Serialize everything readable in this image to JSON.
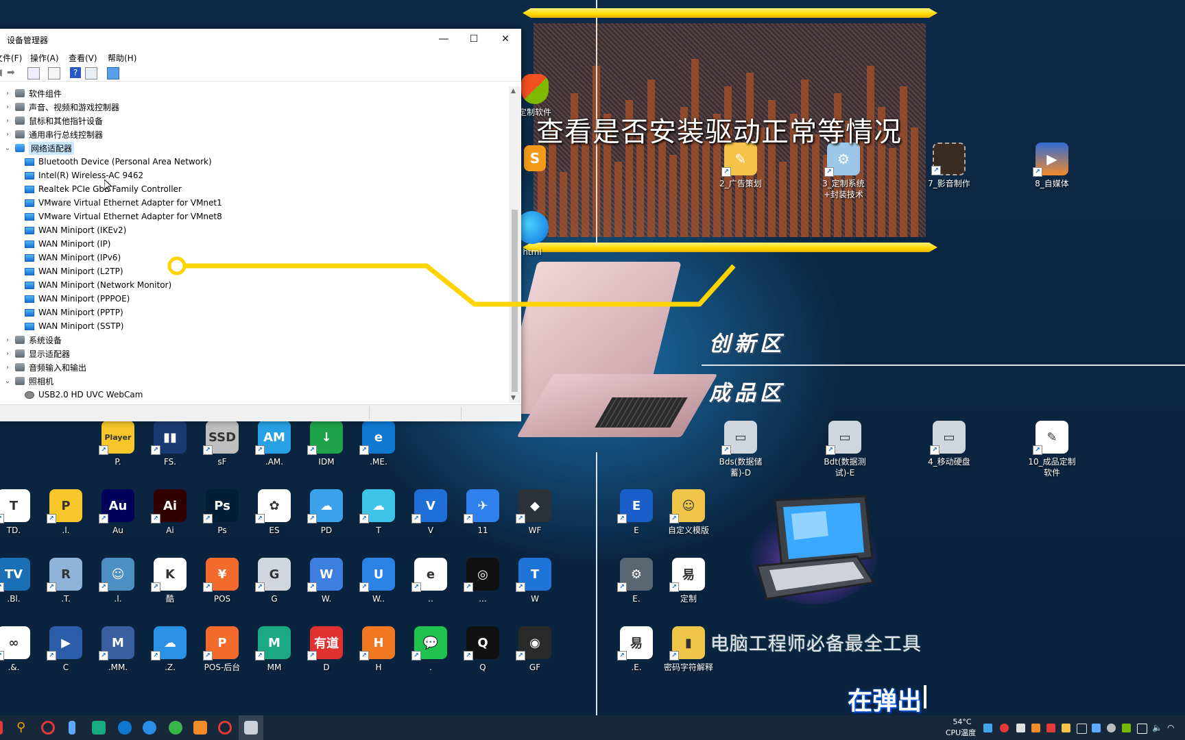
{
  "overlay": {
    "caption": "查看是否安装驱动正常等情况",
    "zone_innovation": "创新区",
    "zone_finished": "成品区",
    "tools_banner": "电脑工程师必备最全工具",
    "popup_text": "在弹出",
    "hud_icons": [
      "定制软件",
      "2_广告策划",
      "3_定制系统+封装技术",
      "7_影音制作",
      "8_自媒体",
      "html"
    ]
  },
  "window": {
    "title": "设备管理器",
    "menu": [
      "文件(F)",
      "操作(A)",
      "查看(V)",
      "帮助(H)"
    ],
    "tree": [
      {
        "label": "软件组件",
        "level": 0,
        "expanded": false
      },
      {
        "label": "声音、视频和游戏控制器",
        "level": 0,
        "expanded": false
      },
      {
        "label": "鼠标和其他指针设备",
        "level": 0,
        "expanded": false
      },
      {
        "label": "通用串行总线控制器",
        "level": 0,
        "expanded": false
      },
      {
        "label": "网络适配器",
        "level": 0,
        "expanded": true,
        "selected": true
      },
      {
        "label": "Bluetooth Device (Personal Area Network)",
        "level": 1
      },
      {
        "label": "Intel(R) Wireless-AC 9462",
        "level": 1
      },
      {
        "label": "Realtek PCIe GbE Family Controller",
        "level": 1
      },
      {
        "label": "VMware Virtual Ethernet Adapter for VMnet1",
        "level": 1
      },
      {
        "label": "VMware Virtual Ethernet Adapter for VMnet8",
        "level": 1
      },
      {
        "label": "WAN Miniport (IKEv2)",
        "level": 1
      },
      {
        "label": "WAN Miniport (IP)",
        "level": 1
      },
      {
        "label": "WAN Miniport (IPv6)",
        "level": 1
      },
      {
        "label": "WAN Miniport (L2TP)",
        "level": 1
      },
      {
        "label": "WAN Miniport (Network Monitor)",
        "level": 1
      },
      {
        "label": "WAN Miniport (PPPOE)",
        "level": 1
      },
      {
        "label": "WAN Miniport (PPTP)",
        "level": 1
      },
      {
        "label": "WAN Miniport (SSTP)",
        "level": 1
      },
      {
        "label": "系统设备",
        "level": 0,
        "expanded": false
      },
      {
        "label": "显示适配器",
        "level": 0,
        "expanded": false
      },
      {
        "label": "音频输入和输出",
        "level": 0,
        "expanded": false
      },
      {
        "label": "照相机",
        "level": 0,
        "expanded": true
      },
      {
        "label": "USB2.0 HD UVC WebCam",
        "level": 1,
        "camera": true
      }
    ]
  },
  "desktop_icons_left": [
    [
      {
        "label": "P.",
        "color": "#f7c72a",
        "glyph": "Player"
      },
      {
        "label": "FS.",
        "color": "#1a3a73",
        "glyph": "▮▮"
      },
      {
        "label": "sF",
        "color": "#bfbfbf",
        "glyph": "SSD"
      },
      {
        "label": ".AM.",
        "color": "#27a0e4",
        "glyph": "AM"
      },
      {
        "label": "IDM",
        "color": "#1ea34b",
        "glyph": "↓"
      },
      {
        "label": ".ME.",
        "color": "#0f79d1",
        "glyph": "e"
      }
    ],
    [
      {
        "label": "TD.",
        "color": "#ffffff",
        "glyph": "T"
      },
      {
        "label": ".l.",
        "color": "#f7c72a",
        "glyph": "P"
      },
      {
        "label": "Au",
        "color": "#00005b",
        "glyph": "Au"
      },
      {
        "label": "Ai",
        "color": "#330000",
        "glyph": "Ai"
      },
      {
        "label": "Ps",
        "color": "#001e36",
        "glyph": "Ps"
      },
      {
        "label": "ES",
        "color": "#ffffff",
        "glyph": "✿"
      },
      {
        "label": "PD",
        "color": "#3aa1ec",
        "glyph": "☁"
      },
      {
        "label": "T",
        "color": "#3fc3e8",
        "glyph": "☁"
      },
      {
        "label": "V",
        "color": "#1f6fd6",
        "glyph": "V"
      },
      {
        "label": "11",
        "color": "#2f80ed",
        "glyph": "✈"
      },
      {
        "label": "WF",
        "color": "#2d3238",
        "glyph": "◆"
      }
    ],
    [
      {
        "label": ".Bl.",
        "color": "#1b6fb5",
        "glyph": "TV"
      },
      {
        "label": ".T.",
        "color": "#8fb2d8",
        "glyph": "R"
      },
      {
        "label": ".l.",
        "color": "#4c8fc2",
        "glyph": "☺"
      },
      {
        "label": "酷",
        "color": "#ffffff",
        "glyph": "K"
      },
      {
        "label": "POS",
        "color": "#f26b2c",
        "glyph": "¥"
      },
      {
        "label": "G",
        "color": "#d0d6dc",
        "glyph": "G"
      },
      {
        "label": "W.",
        "color": "#3c7fe0",
        "glyph": "W"
      },
      {
        "label": "W..",
        "color": "#2b83e4",
        "glyph": "U"
      },
      {
        "label": "..",
        "color": "#ffffff",
        "glyph": "e"
      },
      {
        "label": "...",
        "color": "#111111",
        "glyph": "◎"
      },
      {
        "label": "W",
        "color": "#1f74d8",
        "glyph": "T"
      }
    ],
    [
      {
        "label": ".&.",
        "color": "#ffffff",
        "glyph": "∞"
      },
      {
        "label": "C",
        "color": "#2b5da8",
        "glyph": "▶"
      },
      {
        "label": ".MM.",
        "color": "#3a5fa0",
        "glyph": "M"
      },
      {
        "label": ".Z.",
        "color": "#2a92e6",
        "glyph": "☁"
      },
      {
        "label": "POS-后台",
        "color": "#f26b2c",
        "glyph": "P"
      },
      {
        "label": "MM",
        "color": "#1aa980",
        "glyph": "M"
      },
      {
        "label": "D",
        "color": "#e03030",
        "glyph": "有道"
      },
      {
        "label": "H",
        "color": "#f07820",
        "glyph": "H"
      },
      {
        "label": ".",
        "color": "#20c24f",
        "glyph": "💬"
      },
      {
        "label": "Q",
        "color": "#111111",
        "glyph": "Q"
      },
      {
        "label": "GF",
        "color": "#2a2a2a",
        "glyph": "◉"
      }
    ]
  ],
  "desktop_icons_right": [
    {
      "label": "Bds(数据储蓄)-D",
      "color": "#cfd6dc",
      "glyph": "▭"
    },
    {
      "label": "Bdt(数据测试)-E",
      "color": "#cfd6dc",
      "glyph": "▭"
    },
    {
      "label": "4_移动硬盘",
      "color": "#cfd6dc",
      "glyph": "▭"
    },
    {
      "label": "10_成品定制软件",
      "color": "#ffffff",
      "glyph": "✎"
    },
    {
      "label": "E",
      "color": "#1a5ec9",
      "glyph": "E"
    },
    {
      "label": "自定义模版",
      "color": "#f0c64a",
      "glyph": "☺"
    },
    {
      "label": "E.",
      "color": "#5a6672",
      "glyph": "⚙"
    },
    {
      "label": "定制",
      "color": "#ffffff",
      "glyph": "易"
    },
    {
      "label": ".E.",
      "color": "#ffffff",
      "glyph": "易"
    },
    {
      "label": "密码字符解释",
      "color": "#f0c64a",
      "glyph": "▮"
    }
  ],
  "taskbar": {
    "temp_value": "54°C",
    "temp_label": "CPU温度"
  }
}
